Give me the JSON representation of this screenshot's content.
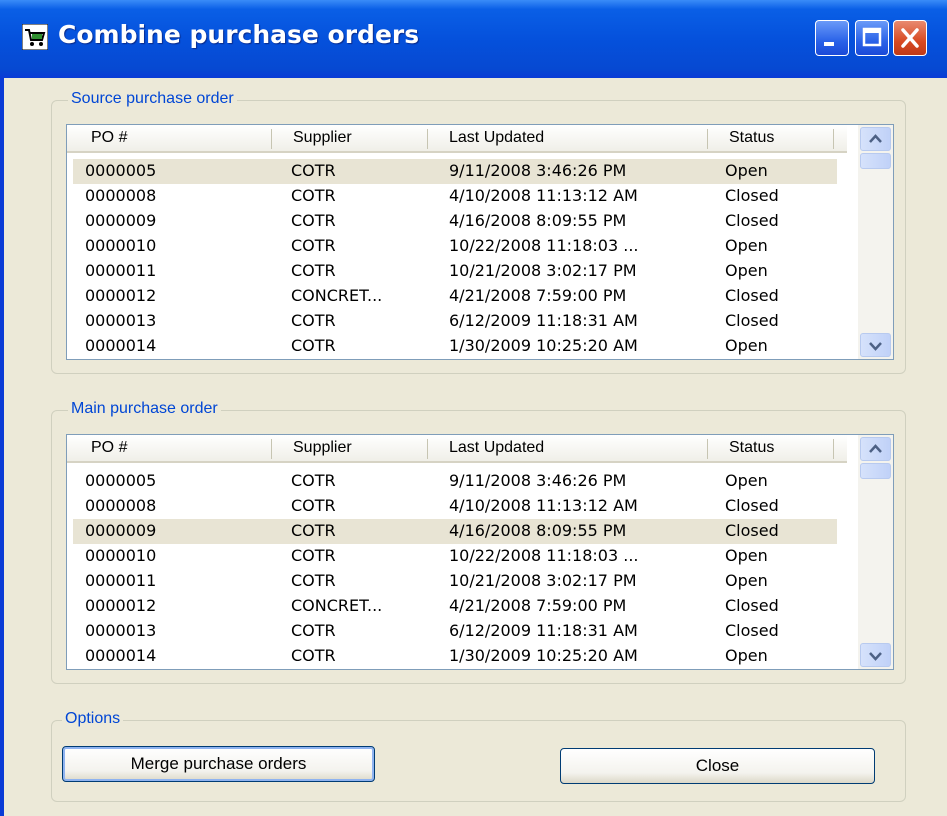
{
  "window": {
    "title": "Combine purchase orders",
    "icons": {
      "app": "cart-icon",
      "minimize": "minimize-icon",
      "maximize": "maximize-icon",
      "close": "close-icon"
    }
  },
  "columns": [
    "PO #",
    "Supplier",
    "Last Updated",
    "Status"
  ],
  "source": {
    "label": "Source purchase order",
    "selected_index": 0,
    "rows": [
      {
        "po": "0000005",
        "supplier": "COTR",
        "updated": "9/11/2008 3:46:26 PM",
        "status": "Open"
      },
      {
        "po": "0000008",
        "supplier": "COTR",
        "updated": "4/10/2008 11:13:12 AM",
        "status": "Closed"
      },
      {
        "po": "0000009",
        "supplier": "COTR",
        "updated": "4/16/2008 8:09:55 PM",
        "status": "Closed"
      },
      {
        "po": "0000010",
        "supplier": "COTR",
        "updated": "10/22/2008 11:18:03 ...",
        "status": "Open"
      },
      {
        "po": "0000011",
        "supplier": "COTR",
        "updated": "10/21/2008 3:02:17 PM",
        "status": "Open"
      },
      {
        "po": "0000012",
        "supplier": "CONCRET...",
        "updated": "4/21/2008 7:59:00 PM",
        "status": "Closed"
      },
      {
        "po": "0000013",
        "supplier": "COTR",
        "updated": "6/12/2009 11:18:31 AM",
        "status": "Closed"
      },
      {
        "po": "0000014",
        "supplier": "COTR",
        "updated": "1/30/2009 10:25:20 AM",
        "status": "Open"
      }
    ]
  },
  "main": {
    "label": "Main purchase order",
    "selected_index": 2,
    "rows": [
      {
        "po": "0000005",
        "supplier": "COTR",
        "updated": "9/11/2008 3:46:26 PM",
        "status": "Open"
      },
      {
        "po": "0000008",
        "supplier": "COTR",
        "updated": "4/10/2008 11:13:12 AM",
        "status": "Closed"
      },
      {
        "po": "0000009",
        "supplier": "COTR",
        "updated": "4/16/2008 8:09:55 PM",
        "status": "Closed"
      },
      {
        "po": "0000010",
        "supplier": "COTR",
        "updated": "10/22/2008 11:18:03 ...",
        "status": "Open"
      },
      {
        "po": "0000011",
        "supplier": "COTR",
        "updated": "10/21/2008 3:02:17 PM",
        "status": "Open"
      },
      {
        "po": "0000012",
        "supplier": "CONCRET...",
        "updated": "4/21/2008 7:59:00 PM",
        "status": "Closed"
      },
      {
        "po": "0000013",
        "supplier": "COTR",
        "updated": "6/12/2009 11:18:31 AM",
        "status": "Closed"
      },
      {
        "po": "0000014",
        "supplier": "COTR",
        "updated": "1/30/2009 10:25:20 AM",
        "status": "Open"
      }
    ]
  },
  "options": {
    "label": "Options",
    "merge_label": "Merge purchase orders",
    "close_label": "Close"
  }
}
